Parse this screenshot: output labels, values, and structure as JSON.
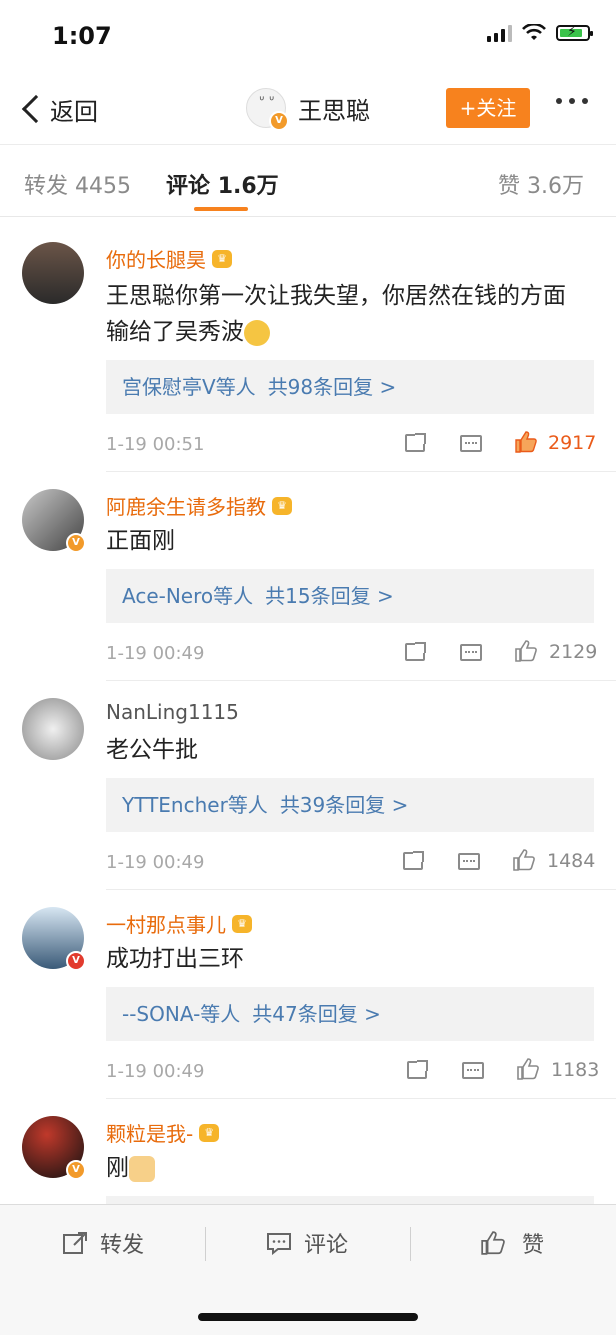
{
  "status": {
    "time": "1:07"
  },
  "header": {
    "back_label": "返回",
    "profile_name": "王思聪",
    "follow_label": "+关注"
  },
  "tabs": [
    {
      "label": "转发",
      "count": "4455"
    },
    {
      "label": "评论",
      "count": "1.6万"
    },
    {
      "label": "赞",
      "count": "3.6万"
    }
  ],
  "comments": [
    {
      "author": "你的长腿昊",
      "text": "王思聪你第一次让我失望，你居然在钱的方面输给了吴秀波",
      "reply_user": "宫保慰亭V",
      "reply_etc": "等人",
      "reply_count": "共98条回复 >",
      "time": "1-19 00:51",
      "likes": "2917"
    },
    {
      "author": "阿鹿余生请多指教",
      "text": "正面刚",
      "reply_user": "Ace-Nero",
      "reply_etc": "等人",
      "reply_count": "共15条回复 >",
      "time": "1-19 00:49",
      "likes": "2129"
    },
    {
      "author": "NanLing1115",
      "text": "老公牛批",
      "reply_user": "YTTEncher",
      "reply_etc": "等人",
      "reply_count": "共39条回复 >",
      "time": "1-19 00:49",
      "likes": "1484"
    },
    {
      "author": "一村那点事儿",
      "text": "成功打出三环",
      "reply_user": "--SONA-",
      "reply_etc": "等人",
      "reply_count": "共47条回复 >",
      "time": "1-19 00:49",
      "likes": "1183"
    },
    {
      "author": "颗粒是我-",
      "text": "刚"
    }
  ],
  "bottom_bar": {
    "repost_label": "转发",
    "comment_label": "评论",
    "like_label": "赞"
  },
  "colors": {
    "accent": "#f7821e",
    "link": "#4a7bb0",
    "username": "#e86b0c",
    "like_active": "#ea5b1a"
  }
}
